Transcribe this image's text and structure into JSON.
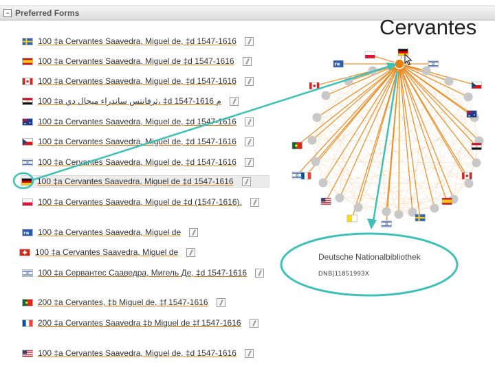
{
  "panel": {
    "title": "Preferred Forms",
    "collapse_icon": "minus-box-icon"
  },
  "rows": [
    {
      "flag": "sweden",
      "text": "100 ‡a  Cervantes Saavedra, Miguel de, ‡d  1547-1616",
      "edit_icon": "edit-pencil-icon"
    },
    {
      "flag": "spain",
      "text": "100 ‡a  Cervantes Saavedra, Miguel de ‡d  1547-1616",
      "edit_icon": "edit-pencil-icon"
    },
    {
      "flag": "canada",
      "text": "100 ‡a  Cervantes Saavedra, Miguel de, ‡d  1547-1616",
      "edit_icon": "edit-pencil-icon"
    },
    {
      "flag": "egypt",
      "text": "100 ‡a  ثرفانتس ساندراء ميجال دي، ‡d  1547-1616 م",
      "edit_icon": "edit-pencil-icon"
    },
    {
      "flag": "australia",
      "text": "100 ‡a  Cervantes Saavedra, Miguel de, ‡d  1547-1616",
      "edit_icon": "edit-pencil-icon"
    },
    {
      "flag": "czech",
      "text": "100 ‡a  Cervantes Saavedra, Miguel de, ‡d  1547-1616",
      "edit_icon": "edit-pencil-icon"
    },
    {
      "flag": "israel",
      "text": "100 ‡a  Cervantes Saavedra, Miguel de, ‡d  1547-1616",
      "edit_icon": "edit-pencil-icon"
    },
    {
      "flag": "germany",
      "text": "100 ‡a  Cervantes Saavedra, Miguel de ‡d  1547-1616",
      "edit_icon": "edit-pencil-icon"
    },
    {
      "flag": "poland",
      "text": "100 ‡a  Cervantes Saavedra, Miguel de ‡d  (1547-1616).",
      "edit_icon": "edit-pencil-icon"
    },
    {
      "flag": "rero",
      "text": "100 ‡a  Cervantes Saavedra, Miguel de",
      "edit_icon": "edit-pencil-icon"
    },
    {
      "flag": "switzerland",
      "text": "100 ‡a  Cervantes Saavedra, Miguel de",
      "edit_icon": "edit-pencil-icon"
    },
    {
      "flag": "israel",
      "text": "100 ‡a  Сервантес Сааведра, Мигель Де, ‡d  1547-1616",
      "edit_icon": "edit-pencil-icon"
    },
    {
      "flag": "portugal",
      "text": "200 ‡a  Cervantes, ‡b  Miguel de, ‡f  1547-1616",
      "edit_icon": "edit-pencil-icon"
    },
    {
      "flag": "france",
      "text": "200 ‡a  Cervantes Saavedra ‡b  Miguel de ‡f  1547-1616",
      "edit_icon": "edit-pencil-icon"
    },
    {
      "flag": "usa",
      "text": "100 ‡a  Cervantes Saavedra, Miguel de, ‡d  1547-1616",
      "edit_icon": "edit-pencil-icon"
    }
  ],
  "highlighted_row": 7,
  "graph": {
    "focus_title": "Cervantes",
    "center_flag": "germany",
    "info_org": "Deutsche Nationalbibliothek",
    "info_id": "DNB|11851993X"
  },
  "colors": {
    "link_underline": "#e07a10",
    "graph_edge": "#f0a860",
    "graph_edge_selected": "#e9800e",
    "annotation_teal": "#3cc0b8",
    "node_gray": "#c8c8c8"
  }
}
